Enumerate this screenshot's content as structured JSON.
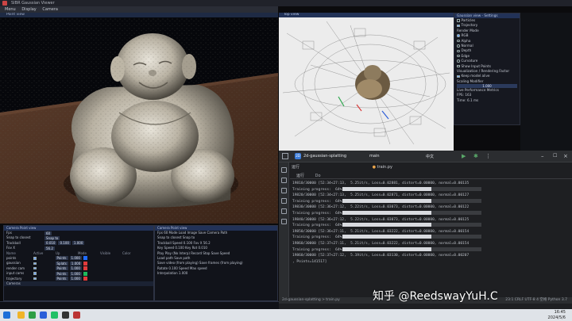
{
  "window": {
    "title": "SIBR Gaussian Viewer",
    "menu": [
      "Menu",
      "Display",
      "Camera"
    ]
  },
  "render_view": {
    "title": "Point view"
  },
  "pointcloud_view": {
    "title": "Top view"
  },
  "side_panel": {
    "title": "Gaussian view - Settings",
    "items": [
      {
        "label": "Particles",
        "type": "checkbox",
        "on": false
      },
      {
        "label": "Trajectory",
        "type": "checkbox",
        "on": true
      },
      {
        "label": "Render Mode",
        "type": "heading"
      },
      {
        "label": "RGB",
        "type": "radio",
        "on": true
      },
      {
        "label": "Alpha",
        "type": "radio",
        "on": false
      },
      {
        "label": "Normal",
        "type": "radio",
        "on": false
      },
      {
        "label": "Depth",
        "type": "radio",
        "on": false
      },
      {
        "label": "Edge",
        "type": "radio",
        "on": false
      },
      {
        "label": "Curvature",
        "type": "radio",
        "on": false
      },
      {
        "label": "Show Input Points",
        "type": "checkbox",
        "on": false
      },
      {
        "label": "Visualization / Rendering Factor",
        "type": "heading"
      },
      {
        "label": "Keep model alive",
        "type": "checkbox",
        "on": true
      }
    ],
    "scaling_label": "Scaling Modifier",
    "scaling_value": "1.000",
    "perf_label": "Live Performance Metrics",
    "fps": "FPS: 163",
    "ms": "Time: 6.1 ms"
  },
  "ide": {
    "project": "2d-gaussian-splatting",
    "branch": "main",
    "lang_tab": "中文",
    "current_file": "train.py",
    "run_tab": "运行",
    "sub_tab": "Do",
    "console_lines": [
      {
        "text": "19810/30000 [52:34<27:13,  5.25it/s, Loss=0.02881, distort=0.00000, normal=0.00135",
        "bar": false
      },
      {
        "text": "Training progress:  64%",
        "bar": true
      },
      {
        "text": "19820/30000 [52:34<27:13,  5.25it/s, Loss=0.02871, distort=0.00000, normal=0.00127",
        "bar": false
      },
      {
        "text": "Training progress:  64%",
        "bar": true
      },
      {
        "text": "19830/30000 [52:36<27:12,  5.22it/s, Loss=0.03073, distort=0.00000, normal=0.00122",
        "bar": false
      },
      {
        "text": "Training progress:  64%",
        "bar": true
      },
      {
        "text": "19840/30000 [52:36<27:12,  5.22it/s, Loss=0.03073, distort=0.00000, normal=0.00125",
        "bar": false
      },
      {
        "text": "Training progress:  64%",
        "bar": true
      },
      {
        "text": "19850/30000 [52:36<27:11,  5.21it/s, Loss=0.03222, distort=0.00000, normal=0.00154",
        "bar": false
      },
      {
        "text": "Training progress:  64%",
        "bar": true
      },
      {
        "text": "19860/30000 [52:37<27:11,  5.21it/s, Loss=0.03222, distort=0.00000, normal=0.00154",
        "bar": false
      },
      {
        "text": "Training progress:  64%",
        "bar": true
      },
      {
        "text": "19860/30000 [52:37<27:12,  5.19it/s, Loss=0.03130, distort=0.00000, normal=0.00207",
        "bar": false
      },
      {
        "text": ", Points=141517]",
        "bar": false
      }
    ],
    "progress_fraction": 0.64,
    "status_left": "2d-gaussian-splatting > train.py",
    "status_right": "23:1   CRLF   UTF-8   4 空格   Python 3.7"
  },
  "watermark": "知乎 @ReedswayYuH.C",
  "control_panel": {
    "title": "Camera Point view",
    "rows": [
      {
        "label": "Fps",
        "values": [
          "60"
        ]
      },
      {
        "label": "Snap to closest",
        "values": [
          "Snap to"
        ]
      },
      {
        "label": "Trackball",
        "values": [
          "0.010",
          "0.100",
          "1.000"
        ]
      },
      {
        "label": "Fov X",
        "values": [
          "56.2"
        ]
      }
    ],
    "cameras_header": [
      "Name",
      "Active",
      "Up",
      "Mode",
      "Visible",
      "Color"
    ],
    "cameras": [
      {
        "name": "points",
        "mode": "Points",
        "value": "1.000",
        "color": "#1f6cff"
      },
      {
        "name": "gaussian",
        "mode": "Splats",
        "value": "1.000",
        "color": "#e23b3b"
      },
      {
        "name": "render cam",
        "mode": "Points",
        "value": "1.000",
        "color": "#e23b3b"
      },
      {
        "name": "input cams",
        "mode": "Points",
        "value": "1.000",
        "color": "#1fb85c"
      },
      {
        "name": "trajectory",
        "mode": "Points",
        "value": "1.000",
        "color": "#e23b3b"
      }
    ],
    "footer": "Cameras"
  },
  "second_panel": {
    "title": "Camera Point view",
    "rows": [
      "Fps  60   Mode  Load Image   Save Camera Path",
      "Snap to closest   Snap to",
      "Trackball   Speed  0.100   Fov X  56.2",
      "Key Speed 0.100   Key Rot 0.010",
      "Play  Play (No Interp)  Record  Stop  Save  Speed",
      "Load path  Save path",
      "Save video (from playing)   Save frames (from playing)",
      "Rotate 0.100   Speed  Max speed",
      "Interpolation  1.000"
    ]
  },
  "taskbar": {
    "time": "16:45",
    "date": "2024/5/6"
  }
}
